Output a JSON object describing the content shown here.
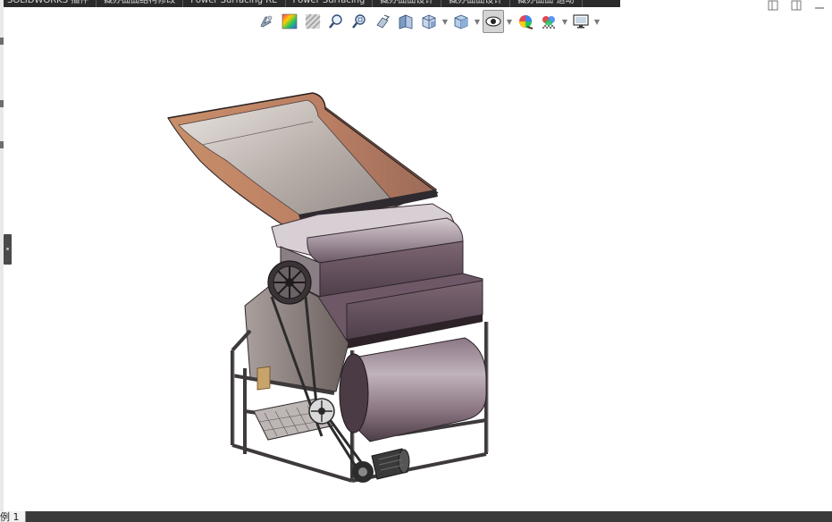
{
  "command_tabs": [
    "SOLIDWORKS 插件",
    "藏办曲曲结构修改",
    "Power Surfacing RE",
    "Power Surfacing",
    "藏办曲曲设计",
    "藏办曲曲设计",
    "藏办曲曲 运动"
  ],
  "hud_toolbar": {
    "buttons": [
      {
        "name": "sketch-fillet-icon",
        "has_caret": false,
        "active": false
      },
      {
        "name": "appearance-icon",
        "has_caret": false,
        "active": false
      },
      {
        "name": "hatch-icon",
        "has_caret": false,
        "active": false
      },
      {
        "name": "zoom-to-fit-icon",
        "has_caret": false,
        "active": false
      },
      {
        "name": "zoom-to-area-icon",
        "has_caret": false,
        "active": false
      },
      {
        "name": "previous-view-icon",
        "has_caret": false,
        "active": false
      },
      {
        "name": "section-view-icon",
        "has_caret": false,
        "active": false
      },
      {
        "name": "view-orientation-icon",
        "has_caret": true,
        "active": false
      },
      {
        "name": "display-style-icon",
        "has_caret": true,
        "active": false
      },
      {
        "name": "hide-show-items-icon",
        "has_caret": true,
        "active": true
      },
      {
        "name": "edit-appearance-icon",
        "has_caret": false,
        "active": false
      },
      {
        "name": "apply-scene-icon",
        "has_caret": true,
        "active": false
      },
      {
        "name": "view-settings-icon",
        "has_caret": true,
        "active": false
      }
    ]
  },
  "window_controls": [
    "tile-left-icon",
    "tile-right-icon",
    "minimize-icon"
  ],
  "sheet_tab": {
    "label": "例 1"
  }
}
